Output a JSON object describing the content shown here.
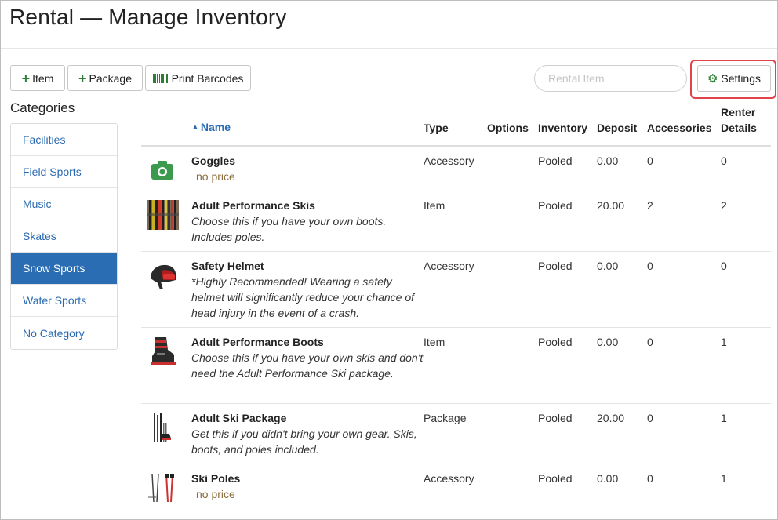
{
  "page": {
    "title": "Rental — Manage Inventory"
  },
  "toolbar": {
    "item_label": "Item",
    "package_label": "Package",
    "barcodes_label": "Print Barcodes",
    "search_placeholder": "Rental Item",
    "settings_label": "Settings",
    "accent_color": "#2e7d32",
    "highlight_color": "#e0444a"
  },
  "categories": {
    "heading": "Categories",
    "items": [
      "Facilities",
      "Field Sports",
      "Music",
      "Skates",
      "Snow Sports",
      "Water Sports",
      "No Category"
    ],
    "active": "Snow Sports"
  },
  "table": {
    "headers": {
      "name": "Name",
      "type": "Type",
      "options": "Options",
      "inventory": "Inventory",
      "deposit": "Deposit",
      "accessories": "Accessories",
      "renter_details_1": "Renter",
      "renter_details_2": "Details"
    },
    "rows": [
      {
        "image_icon": "camera-icon",
        "name": "Goggles",
        "desc": "",
        "price_note": "no price",
        "type": "Accessory",
        "options": "",
        "inventory": "Pooled",
        "deposit": "0.00",
        "accessories": "0",
        "renter_details": "0"
      },
      {
        "image_icon": "skis-photo",
        "name": "Adult Performance Skis",
        "desc": "Choose this if you have your own boots. Includes poles.",
        "price_note": "",
        "type": "Item",
        "options": "",
        "inventory": "Pooled",
        "deposit": "20.00",
        "accessories": "2",
        "renter_details": "2"
      },
      {
        "image_icon": "helmet-photo",
        "name": "Safety Helmet",
        "desc": "*Highly Recommended! Wearing a safety helmet will significantly reduce your chance of head injury in the event of a crash.",
        "price_note": "",
        "type": "Accessory",
        "options": "",
        "inventory": "Pooled",
        "deposit": "0.00",
        "accessories": "0",
        "renter_details": "0"
      },
      {
        "image_icon": "ski-boot-photo",
        "name": "Adult Performance Boots",
        "desc": "Choose this if you have your own skis and don't need the Adult Performance Ski package.",
        "price_note": "",
        "type": "Item",
        "options": "",
        "inventory": "Pooled",
        "deposit": "0.00",
        "accessories": "0",
        "renter_details": "1"
      },
      {
        "image_icon": "ski-package-photo",
        "name": "Adult Ski Package",
        "desc": "Get this if you didn't bring your own gear. Skis, boots, and poles included.",
        "price_note": "",
        "type": "Package",
        "options": "",
        "inventory": "Pooled",
        "deposit": "20.00",
        "accessories": "0",
        "renter_details": "1"
      },
      {
        "image_icon": "ski-poles-photo",
        "name": "Ski Poles",
        "desc": "",
        "price_note": "no price",
        "type": "Accessory",
        "options": "",
        "inventory": "Pooled",
        "deposit": "0.00",
        "accessories": "0",
        "renter_details": "1"
      }
    ]
  }
}
